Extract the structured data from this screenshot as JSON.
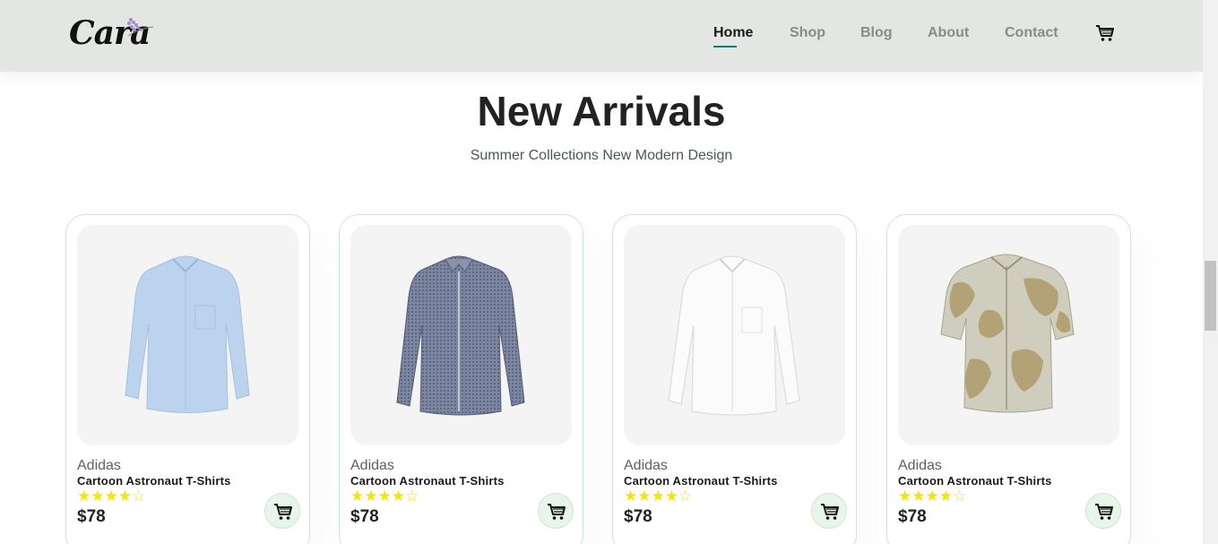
{
  "header": {
    "logo_text": "Cara",
    "nav": [
      {
        "label": "Home",
        "active": true
      },
      {
        "label": "Shop",
        "active": false
      },
      {
        "label": "Blog",
        "active": false
      },
      {
        "label": "About",
        "active": false
      },
      {
        "label": "Contact",
        "active": false
      }
    ],
    "cart_icon": "cart-icon"
  },
  "section": {
    "title": "New Arrivals",
    "subtitle": "Summer Collections New Modern Design"
  },
  "products": [
    {
      "brand": "Adidas",
      "name": "Cartoon Astronaut T-Shirts",
      "stars": "★★★★☆",
      "rating": 4,
      "price": "$78",
      "image": "light-blue-shirt",
      "color": "#bcd3ee"
    },
    {
      "brand": "Adidas",
      "name": "Cartoon Astronaut T-Shirts",
      "stars": "★★★★☆",
      "rating": 4,
      "price": "$78",
      "image": "navy-check-shirt",
      "color": "#6f7892"
    },
    {
      "brand": "Adidas",
      "name": "Cartoon Astronaut T-Shirts",
      "stars": "★★★★☆",
      "rating": 4,
      "price": "$78",
      "image": "white-shirt",
      "color": "#f4f4f4"
    },
    {
      "brand": "Adidas",
      "name": "Cartoon Astronaut T-Shirts",
      "stars": "★★★★☆",
      "rating": 4,
      "price": "$78",
      "image": "floral-short-sleeve-shirt",
      "color": "#c9c6b4"
    }
  ],
  "colors": {
    "accent": "#088178",
    "star": "#f3e600",
    "header_bg": "#e3e6e3",
    "card_border": "#cce7d0"
  }
}
